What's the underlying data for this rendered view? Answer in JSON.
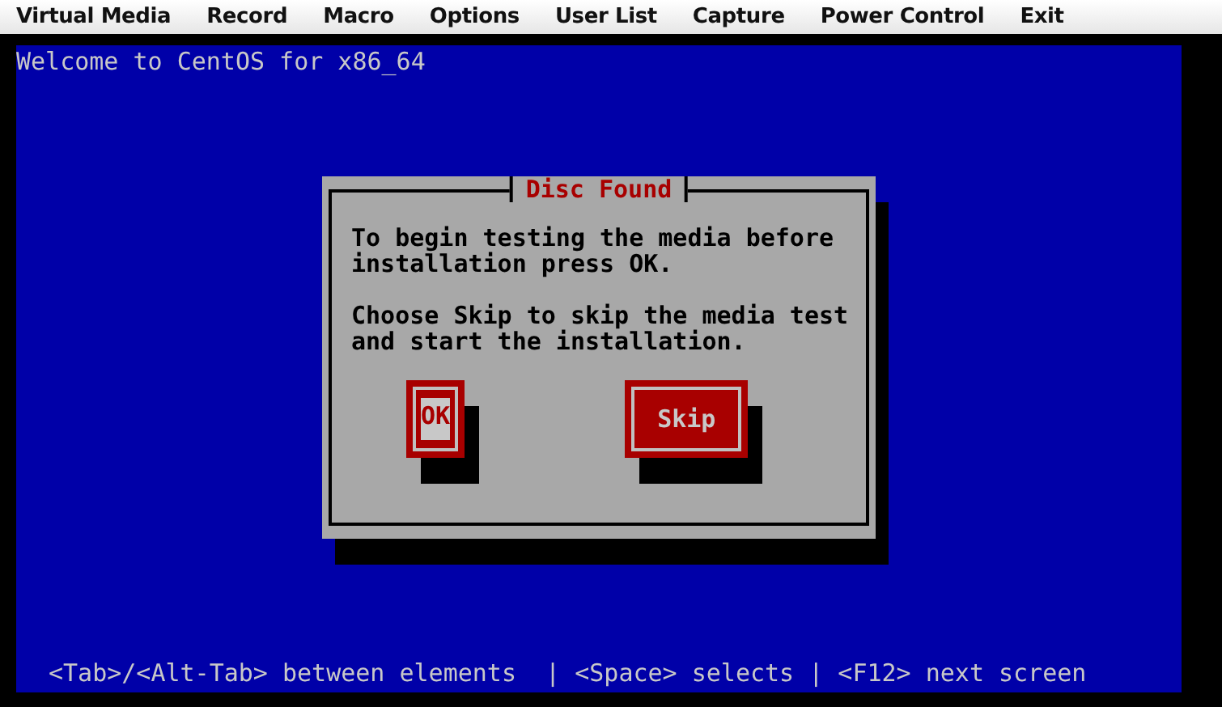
{
  "menu_bar": {
    "items": [
      "Virtual Media",
      "Record",
      "Macro",
      "Options",
      "User List",
      "Capture",
      "Power Control",
      "Exit"
    ]
  },
  "console": {
    "header": "Welcome to CentOS for x86_64",
    "dialog": {
      "title": "Disc Found",
      "paragraphs": [
        "To begin testing the media before\ninstallation press OK.",
        "Choose Skip to skip the media test\nand start the installation."
      ],
      "buttons": [
        {
          "label": "OK",
          "selected": true
        },
        {
          "label": "Skip",
          "selected": false
        }
      ]
    },
    "status_line": "<Tab>/<Alt-Tab> between elements  | <Space> selects | <F12> next screen"
  }
}
